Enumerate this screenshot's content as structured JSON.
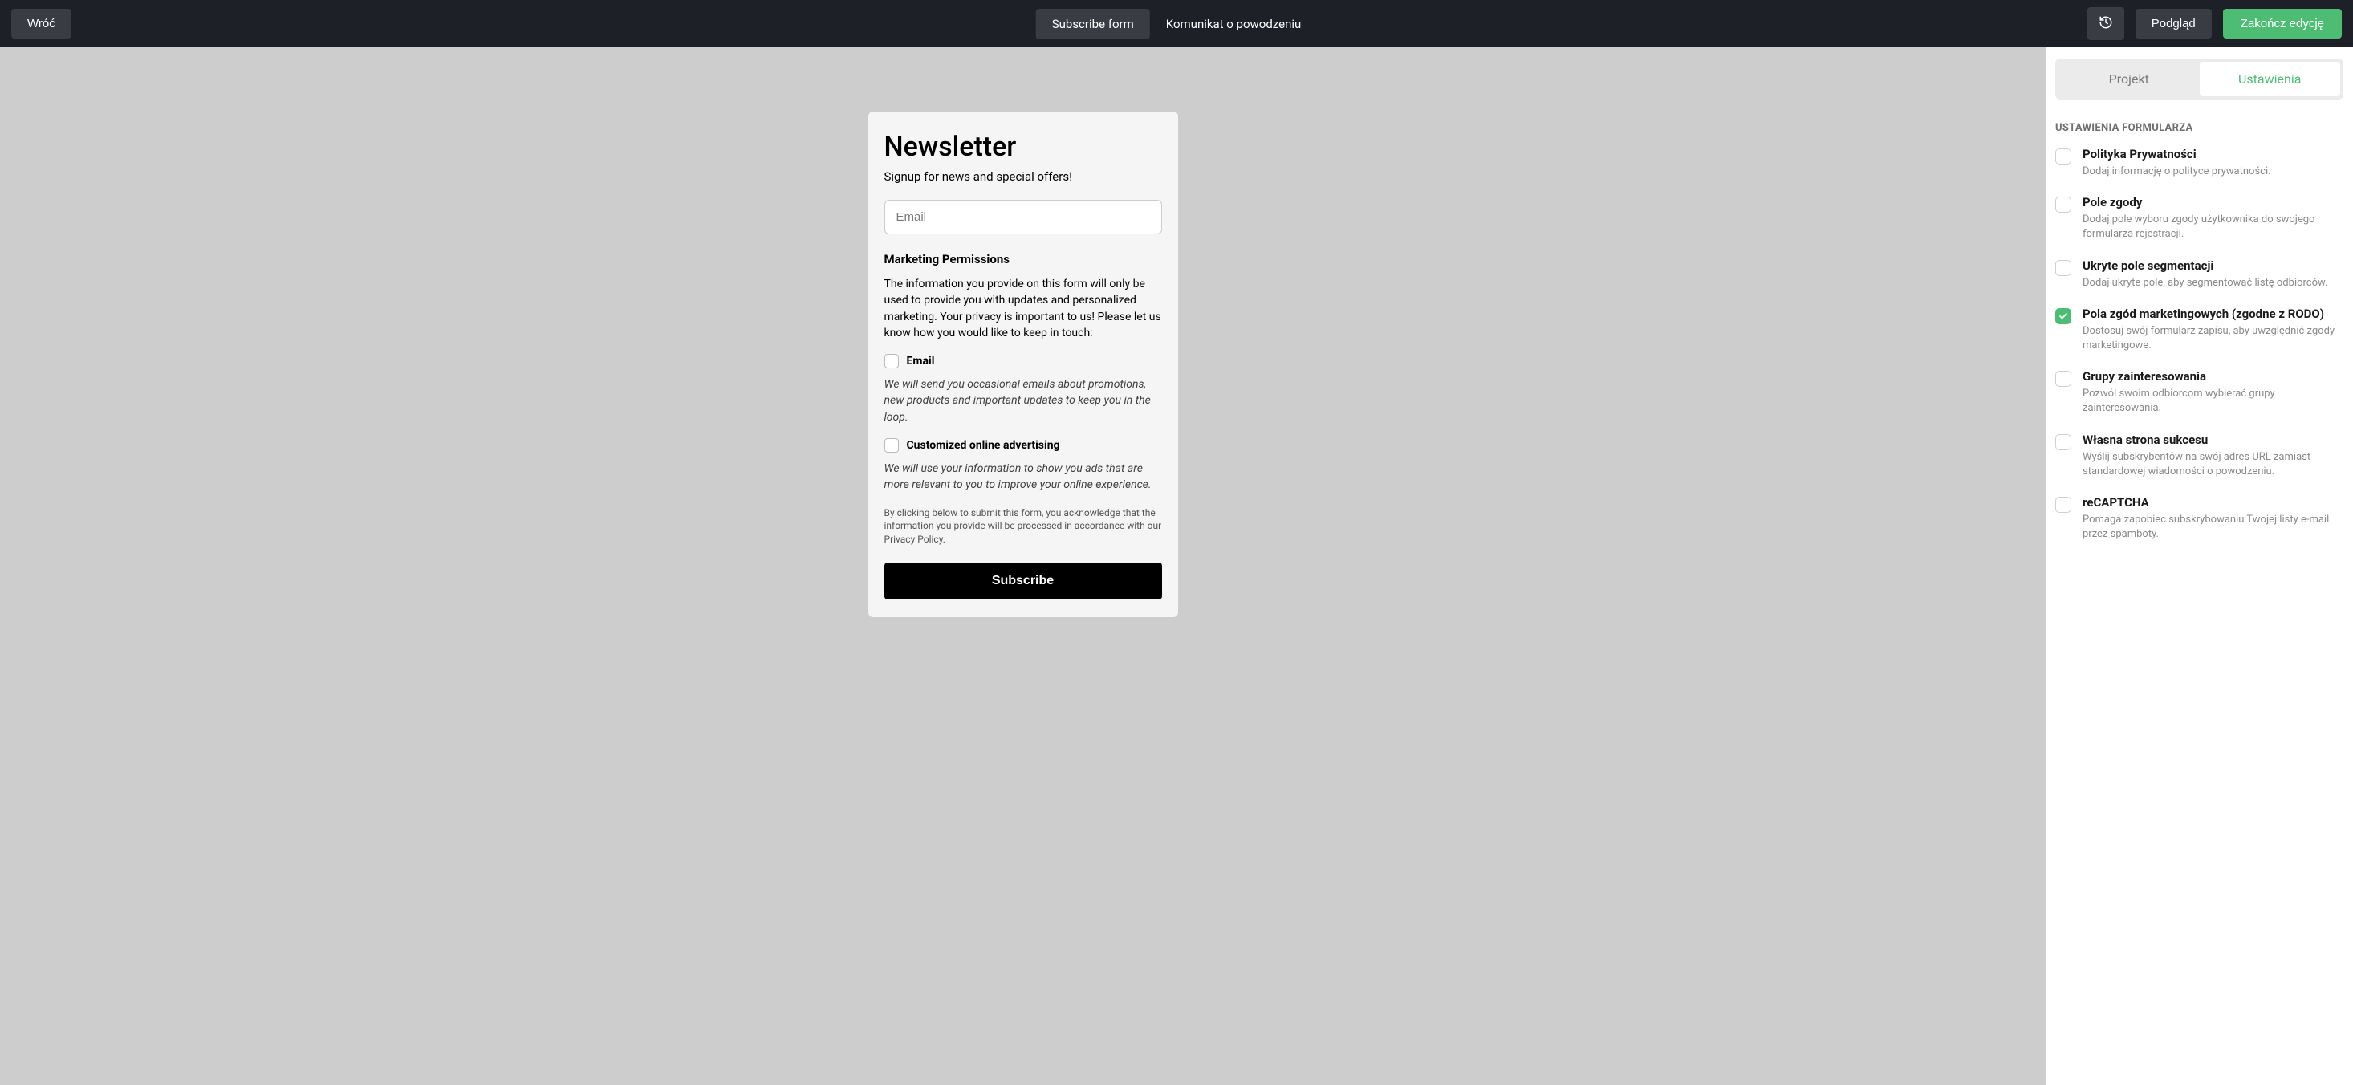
{
  "topbar": {
    "back": "Wróć",
    "tab1": "Subscribe form",
    "tab2": "Komunikat o powodzeniu",
    "preview": "Podgląd",
    "finish": "Zakończ edycję"
  },
  "form": {
    "title": "Newsletter",
    "subtitle": "Signup for news and special offers!",
    "email_placeholder": "Email",
    "perm_heading": "Marketing Permissions",
    "perm_text": "The information you provide on this form will only be used to provide you with updates and personalized marketing. Your privacy is important to us! Please let us know how you would like to keep in touch:",
    "perm1_label": "Email",
    "perm1_desc": "We will send you occasional emails about promotions, new products and important updates to keep you in the loop.",
    "perm2_label": "Customized online advertising",
    "perm2_desc": "We will use your information to show you ads that are more relevant to you to improve your online experience.",
    "legal": "By clicking below to submit this form, you acknowledge that the information you provide will be processed in accordance with our Privacy Policy.",
    "subscribe": "Subscribe"
  },
  "sidebar": {
    "tab1": "Projekt",
    "tab2": "Ustawienia",
    "heading": "USTAWIENIA FORMULARZA",
    "items": [
      {
        "title": "Polityka Prywatności",
        "desc": "Dodaj informację o polityce prywatności.",
        "checked": false
      },
      {
        "title": "Pole zgody",
        "desc": "Dodaj pole wyboru zgody użytkownika do swojego formularza rejestracji.",
        "checked": false
      },
      {
        "title": "Ukryte pole segmentacji",
        "desc": "Dodaj ukryte pole, aby segmentować listę odbiorców.",
        "checked": false
      },
      {
        "title": "Pola zgód marketingowych (zgodne z RODO)",
        "desc": "Dostosuj swój formularz zapisu, aby uwzględnić zgody marketingowe.",
        "checked": true
      },
      {
        "title": "Grupy zainteresowania",
        "desc": "Pozwól swoim odbiorcom wybierać grupy zainteresowania.",
        "checked": false
      },
      {
        "title": "Własna strona sukcesu",
        "desc": "Wyślij subskrybentów na swój adres URL zamiast standardowej wiadomości o powodzeniu.",
        "checked": false
      },
      {
        "title": "reCAPTCHA",
        "desc": "Pomaga zapobiec subskrybowaniu Twojej listy e-mail przez spamboty.",
        "checked": false
      }
    ]
  }
}
